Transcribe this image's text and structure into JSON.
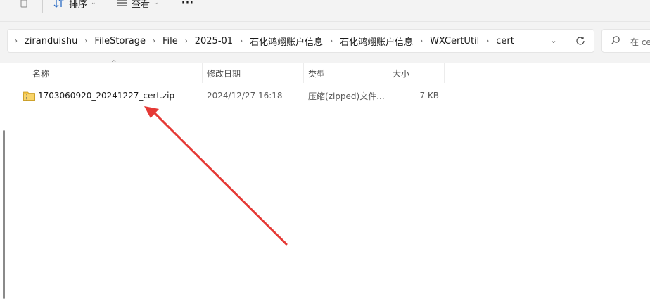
{
  "toolbar": {
    "sort_label": "排序",
    "view_label": "查看",
    "more_label": "···"
  },
  "address_bar": {
    "breadcrumbs": [
      "ziranduishu",
      "FileStorage",
      "File",
      "2025-01",
      "石化鸿翊账户信息",
      "石化鸿翊账户信息",
      "WXCertUtil",
      "cert"
    ]
  },
  "search": {
    "placeholder": "在 ce"
  },
  "columns": {
    "name": "名称",
    "modified": "修改日期",
    "type": "类型",
    "size": "大小"
  },
  "files": [
    {
      "name": "1703060920_20241227_cert.zip",
      "modified": "2024/12/27 16:18",
      "type": "压缩(zipped)文件...",
      "size": "7 KB",
      "icon": "zip-folder-icon"
    }
  ],
  "colors": {
    "annotation_arrow": "#e53935",
    "zip_icon": "#f3c343"
  }
}
